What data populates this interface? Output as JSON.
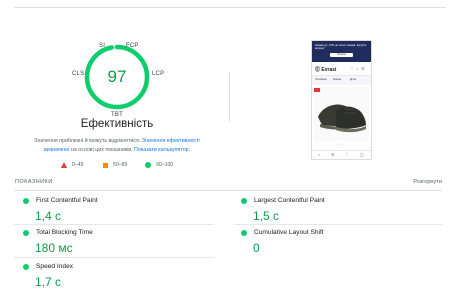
{
  "gauge": {
    "score": "97",
    "score_fraction": 0.97,
    "title": "Ефективність",
    "segment_labels": {
      "si": "SI",
      "fcp": "FCP",
      "lcp": "LCP",
      "tbt": "TBT",
      "cls": "CLS"
    },
    "color": "#0cce6b",
    "track_color": "#d8f5e3"
  },
  "note": {
    "text": "Значення приблизні й можуть відрізнятися. ",
    "link1": "Значення ефективності визначено",
    "middle": " на основі цих показників. ",
    "link2": "Показати калькулятор."
  },
  "legend": {
    "poor": "0–49",
    "average": "50–89",
    "good": "90–100",
    "colors": {
      "poor": "#e53935",
      "average": "#fb8c00",
      "good": "#0cce6b"
    }
  },
  "screenshot": {
    "banner_text": "Знижки до -70% на тисячі товарів. Купуйте вигідно!",
    "banner_button": "Перейти",
    "logo": "Ⓔ Evrasi",
    "icons": "♡ ⌂ ☰",
    "tabs": [
      "Чоловікам",
      "Жінкам",
      "Дітям"
    ],
    "nav_icons": "⌂ ☰ ♡ ◯"
  },
  "metrics": {
    "title": "ПОКАЗНИКИ",
    "toggle": "Розгорнути",
    "items": [
      {
        "name": "First Contentful Paint",
        "value": "1,4 с"
      },
      {
        "name": "Largest Contentful Paint",
        "value": "1,5 с"
      },
      {
        "name": "Total Blocking Time",
        "value": "180 мс"
      },
      {
        "name": "Cumulative Layout Shift",
        "value": "0"
      },
      {
        "name": "Speed Index",
        "value": "1,7 с"
      }
    ]
  }
}
